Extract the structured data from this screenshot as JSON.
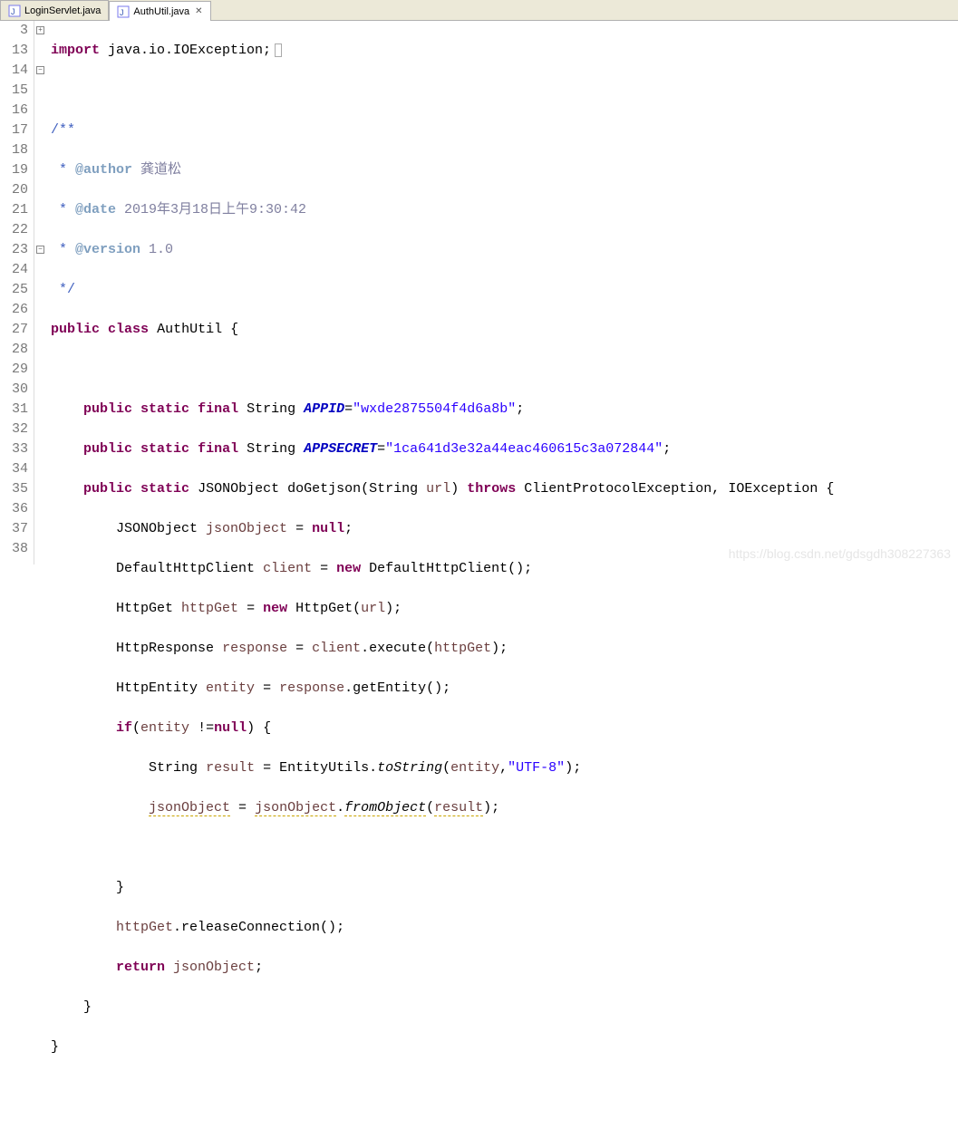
{
  "tabs": [
    {
      "label": "LoginServlet.java",
      "active": false
    },
    {
      "label": "AuthUtil.java",
      "active": true
    }
  ],
  "watermark": "https://blog.csdn.net/gdsgdh308227363",
  "code": {
    "l3": {
      "num": "3",
      "text_prefix": "import",
      "text_rest": " java.io.IOException;"
    },
    "l13": {
      "num": "13"
    },
    "l14": {
      "num": "14",
      "open": "/**"
    },
    "l15": {
      "num": "15",
      "star": " * ",
      "tag": "@author",
      "val": " 龚道松"
    },
    "l16": {
      "num": "16",
      "star": " * ",
      "tag": "@date",
      "val": " 2019年3月18日上午9:30:42"
    },
    "l17": {
      "num": "17",
      "star": " * ",
      "tag": "@version",
      "val": " 1.0"
    },
    "l18": {
      "num": "18",
      "close": " */"
    },
    "l19": {
      "num": "19",
      "kw1": "public",
      "kw2": "class",
      "name": "AuthUtil",
      "brace": " {"
    },
    "l20": {
      "num": "20"
    },
    "l21": {
      "num": "21",
      "indent": "    ",
      "kw1": "public",
      "kw2": "static",
      "kw3": "final",
      "type": "String",
      "field": "APPID",
      "eq": "=",
      "str": "\"wxde2875504f4d6a8b\"",
      "semi": ";"
    },
    "l22": {
      "num": "22",
      "indent": "    ",
      "kw1": "public",
      "kw2": "static",
      "kw3": "final",
      "type": "String",
      "field": "APPSECRET",
      "eq": "=",
      "str": "\"1ca641d3e32a44eac460615c3a072844\"",
      "semi": ";"
    },
    "l23": {
      "num": "23",
      "indent": "    ",
      "kw1": "public",
      "kw2": "static",
      "type": "JSONObject",
      "mname": "doGetjson",
      "paren_open": "(",
      "ptype": "String",
      "pname": "url",
      "paren_close": ")",
      "kw3": "throws",
      "ex1": "ClientProtocolException",
      "comma": ", ",
      "ex2": "IOException",
      "brace": " {"
    },
    "l24": {
      "num": "24",
      "indent": "        ",
      "type": "JSONObject",
      "var": "jsonObject",
      "eq": " = ",
      "kw": "null",
      "semi": ";"
    },
    "l25": {
      "num": "25",
      "indent": "        ",
      "type": "DefaultHttpClient",
      "var": "client",
      "eq": " = ",
      "kw": "new",
      "ctor": " DefaultHttpClient()",
      "semi": ";"
    },
    "l26": {
      "num": "26",
      "indent": "        ",
      "type": "HttpGet",
      "var": "httpGet",
      "eq": " = ",
      "kw": "new",
      "ctor": " HttpGet(",
      "arg": "url",
      "close": ")",
      "semi": ";"
    },
    "l27": {
      "num": "27",
      "indent": "        ",
      "type": "HttpResponse",
      "var": "response",
      "eq": " = ",
      "obj": "client",
      "call": ".execute(",
      "arg": "httpGet",
      "close": ")",
      "semi": ";"
    },
    "l28": {
      "num": "28",
      "indent": "        ",
      "type": "HttpEntity",
      "var": "entity",
      "eq": " = ",
      "obj": "response",
      "call": ".getEntity()",
      "semi": ";"
    },
    "l29": {
      "num": "29",
      "indent": "        ",
      "kw": "if",
      "open": "(",
      "obj": "entity",
      "op": " !=",
      "nul": "null",
      "close": ") {"
    },
    "l30": {
      "num": "30",
      "indent": "            ",
      "type": "String",
      "var": "result",
      "eq": " = EntityUtils.",
      "method": "toString",
      "open": "(",
      "arg1": "entity",
      "comma": ",",
      "str": "\"UTF-8\"",
      "close": ")",
      "semi": ";"
    },
    "l31": {
      "num": "31",
      "indent": "            ",
      "lhs": "jsonObject",
      "eq": " = ",
      "obj": "jsonObject",
      "dot": ".",
      "method": "fromObject",
      "open": "(",
      "arg": "result",
      "close": ")",
      "semi": ";"
    },
    "l32": {
      "num": "32"
    },
    "l33": {
      "num": "33",
      "indent": "        ",
      "brace": "}"
    },
    "l34": {
      "num": "34",
      "indent": "        ",
      "obj": "httpGet",
      "call": ".releaseConnection()",
      "semi": ";"
    },
    "l35": {
      "num": "35",
      "indent": "        ",
      "kw": "return",
      "var": " jsonObject",
      "semi": ";"
    },
    "l36": {
      "num": "36",
      "indent": "    ",
      "brace": "}"
    },
    "l37": {
      "num": "37",
      "brace": "}"
    },
    "l38": {
      "num": "38"
    }
  }
}
